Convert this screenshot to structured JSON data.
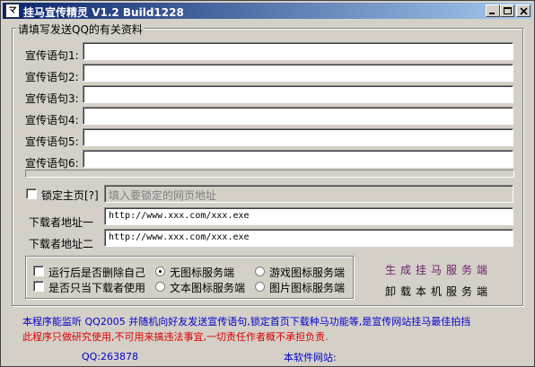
{
  "window": {
    "title": "挂马宣传精灵 V1.2  Build1228",
    "icon_label": "マ"
  },
  "colors": {
    "titlebar_start": "#0a246a",
    "titlebar_end": "#a6caf0",
    "link_purple": "#6b1f6b",
    "footer_blue": "#0000cc",
    "footer_red": "#dd0000"
  },
  "icons": {
    "minimize": "minimize-icon",
    "maximize": "maximize-icon",
    "close": "close-icon"
  },
  "group": {
    "legend": "请填写发送QQ的有关资料"
  },
  "slogans": [
    {
      "label": "宣传语句1:",
      "value": ""
    },
    {
      "label": "宣传语句2:",
      "value": ""
    },
    {
      "label": "宣传语句3:",
      "value": ""
    },
    {
      "label": "宣传语句4:",
      "value": ""
    },
    {
      "label": "宣传语句5:",
      "value": ""
    },
    {
      "label": "宣传语句6:",
      "value": ""
    }
  ],
  "lock": {
    "checkbox_label": "锁定主页[?]",
    "placeholder": "填入要锁定的网页地址",
    "checked": false
  },
  "download": {
    "url1_label": "下载者地址一",
    "url1_value": "http://www.xxx.com/xxx.exe",
    "url2_label": "下载者地址二",
    "url2_value": "http://www.xxx.com/xxx.exe"
  },
  "options": {
    "delete_self": "运行后是否删除自己",
    "downloader_only": "是否只当下载者使用",
    "icon_none": "无图标服务端",
    "icon_game": "游戏图标服务端",
    "icon_text": "文本图标服务端",
    "icon_image": "图片图标服务端",
    "selected_icon": "icon_none"
  },
  "actions": {
    "generate": "生成挂马服务端",
    "uninstall": "卸载本机服务端"
  },
  "footer": {
    "desc": "本程序能监听 QQ2005 并随机向好友发送宣传语句,锁定首页下载种马功能等,是宣传网站挂马最佳拍挡",
    "warning": "此程序只做研究使用,不可用来搞违法事宜,一切责任作者概不承担负责.",
    "qq": "QQ:263878",
    "website": "本软件网站:"
  }
}
